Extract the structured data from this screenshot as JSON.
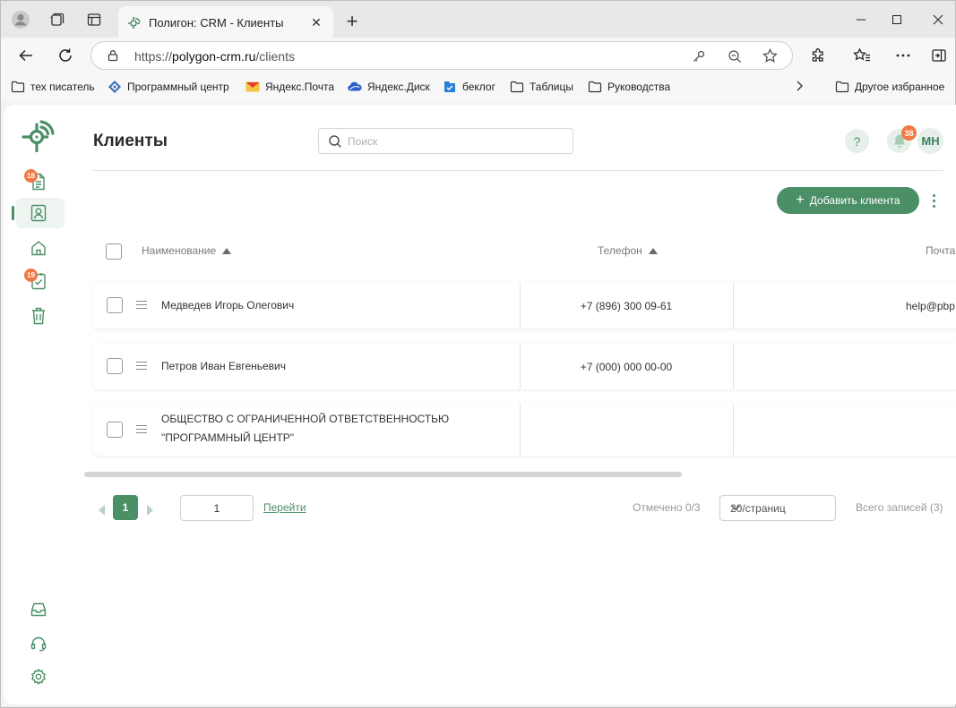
{
  "browser": {
    "tab_title": "Полигон: CRM - Клиенты",
    "url_scheme": "https://",
    "url_host": "polygon-crm.ru",
    "url_path": "/clients",
    "bookmarks": [
      {
        "label": "тех писатель",
        "icon": "folder-icon"
      },
      {
        "label": "Программный центр",
        "icon": "program-center-icon"
      },
      {
        "label": "Яндекс.Почта",
        "icon": "mail-icon"
      },
      {
        "label": "Яндекс.Диск",
        "icon": "cloud-disk-icon"
      },
      {
        "label": "беклог",
        "icon": "backlog-icon"
      },
      {
        "label": "Таблицы",
        "icon": "folder-icon"
      },
      {
        "label": "Руководства",
        "icon": "folder-icon"
      }
    ],
    "other_bookmarks": "Другое избранное"
  },
  "sidebar": {
    "items": [
      {
        "name": "documents",
        "badge": "18"
      },
      {
        "name": "clients",
        "active": true
      },
      {
        "name": "home"
      },
      {
        "name": "tasks",
        "badge": "19"
      },
      {
        "name": "trash"
      },
      {
        "name": "inbox"
      },
      {
        "name": "support"
      },
      {
        "name": "settings"
      }
    ]
  },
  "header": {
    "title": "Клиенты",
    "search_placeholder": "Поиск",
    "help_label": "?",
    "notifications_count": "38",
    "avatar_initials": "МН"
  },
  "toolbar": {
    "add_label": "Добавить клиента"
  },
  "table": {
    "columns": [
      "Наименование",
      "Телефон",
      "Почта"
    ],
    "rows": [
      {
        "name": "Медведев Игорь Олегович",
        "phone": "+7 (896) 300 09-61",
        "email": "help@pbp"
      },
      {
        "name": "Петров Иван Евгеньевич",
        "phone": "+7 (000) 000 00-00",
        "email": ""
      },
      {
        "name_line1": "ОБЩЕСТВО С ОГРАНИЧЕННОЙ ОТВЕТСТВЕННОСТЬЮ",
        "name_line2": "\"ПРОГРАММНЫЙ ЦЕНТР\"",
        "phone": "",
        "email": ""
      }
    ]
  },
  "pagination": {
    "current_page": "1",
    "goto_value": "1",
    "goto_label": "Перейти",
    "selected": "Отмечено 0/3",
    "per_page": "20/страниц",
    "total": "Всего записей (3)"
  },
  "colors": {
    "accent": "#4a8f66",
    "badge": "#f07a45",
    "accent_light": "#e6efe9"
  }
}
